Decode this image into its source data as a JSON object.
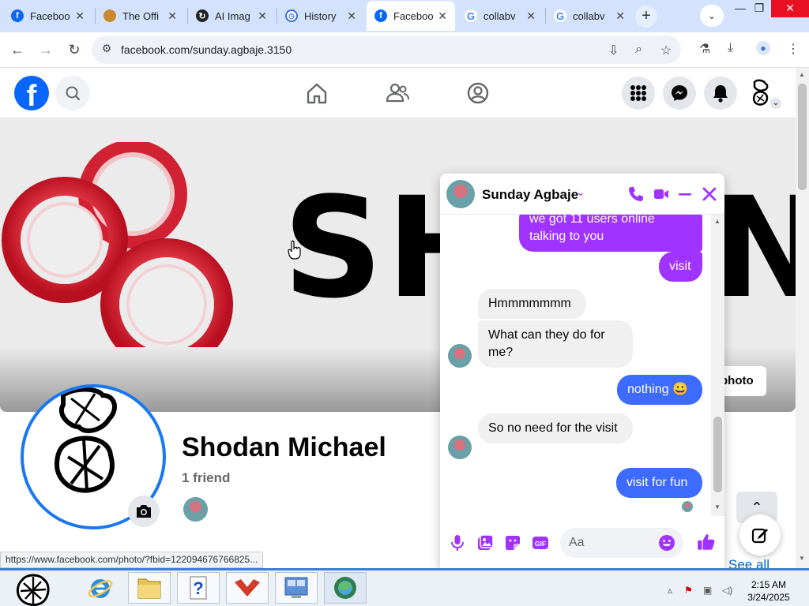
{
  "browser": {
    "tabs": [
      {
        "title": "Faceboo",
        "active": false
      },
      {
        "title": "The Offi",
        "active": false
      },
      {
        "title": "AI Imag",
        "active": false
      },
      {
        "title": "History",
        "active": false
      },
      {
        "title": "Faceboo",
        "active": true
      },
      {
        "title": "collabv",
        "active": false
      },
      {
        "title": "collabv",
        "active": false
      }
    ],
    "new_tab": "+",
    "url": "facebook.com/sunday.agbaje.3150",
    "status_url": "https://www.facebook.com/photo/?fbid=122094676766825..."
  },
  "cover": {
    "text": "SH",
    "text_end": "N",
    "edit_button": "photo"
  },
  "profile": {
    "name": "Shodan Michael",
    "friends": "1 friend",
    "see_all": "See all"
  },
  "chat": {
    "contact_name": "Sunday Agbaje",
    "messages": [
      {
        "dir": "out",
        "text": "we got 11 users online talking to you"
      },
      {
        "dir": "out",
        "text": "visit"
      },
      {
        "dir": "in",
        "text": "Hmmmmmmm"
      },
      {
        "dir": "in",
        "text": "What can they do for me?"
      },
      {
        "dir": "out",
        "text": "nothing 😀"
      },
      {
        "dir": "in",
        "text": "So no need for the visit"
      },
      {
        "dir": "out",
        "text": "visit for fun"
      }
    ],
    "composer_placeholder": "Aa"
  },
  "taskbar": {
    "time": "2:15 AM",
    "date": "3/24/2025"
  },
  "colors": {
    "facebook_blue": "#0866ff",
    "messenger_purple": "#a033ff",
    "bubble_blue": "#3d6bff",
    "tab_bar": "#d3e3fd",
    "close_red": "#e81123"
  }
}
